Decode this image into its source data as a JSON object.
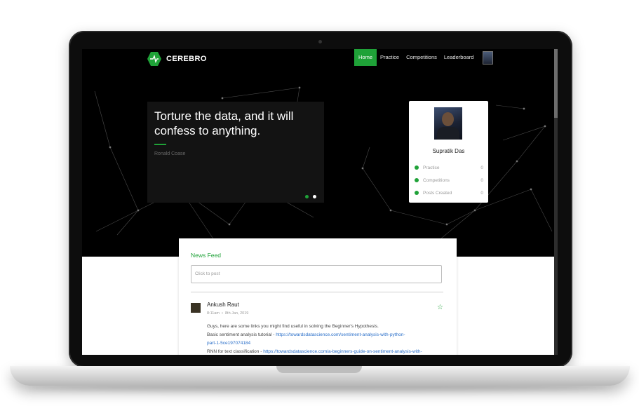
{
  "brand": {
    "name": "CEREBRO"
  },
  "nav": {
    "items": [
      {
        "label": "Home",
        "active": true
      },
      {
        "label": "Practice",
        "active": false
      },
      {
        "label": "Competitions",
        "active": false
      },
      {
        "label": "Leaderboard",
        "active": false
      }
    ]
  },
  "hero": {
    "quote": "Torture the data, and it will confess to anything.",
    "author": "Ronald Coase",
    "carousel_dots": 2
  },
  "profile": {
    "name": "Supratik Das",
    "stats": [
      {
        "label": "Practice",
        "value": "0"
      },
      {
        "label": "Competitions",
        "value": "0"
      },
      {
        "label": "Posts Created",
        "value": "0"
      }
    ]
  },
  "feed": {
    "title": "News Feed",
    "post_placeholder": "Click to post",
    "post": {
      "author": "Ankush Raut",
      "time": "8:11am",
      "date": "8th Jan, 2019",
      "line1": "Guys, here are some links you might find useful in solving the Beginner's Hypothesis.",
      "line2_text": "Basic sentiment analysis tutorial - ",
      "line2_link": "https://towardsdatascience.com/sentiment-analysis-with-python-",
      "line3_link": "part-1-5ce197074184",
      "line4_text": "RNN for text classification - ",
      "line4_link": "https://towardsdatascience.com/a-beginners-guide-on-sentiment-analysis-with-"
    }
  },
  "colors": {
    "accent": "#1fa238",
    "hero_bg": "#000000",
    "link": "#2a6fc9"
  }
}
